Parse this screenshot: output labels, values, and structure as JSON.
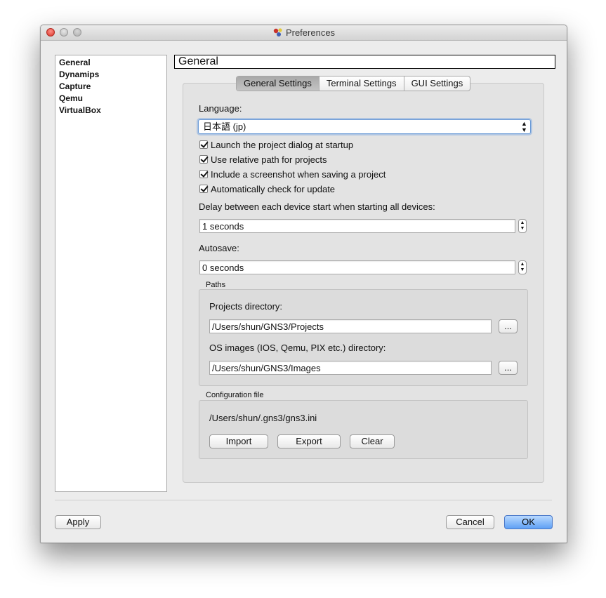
{
  "window": {
    "title": "Preferences"
  },
  "sidebar": {
    "items": [
      {
        "label": "General"
      },
      {
        "label": "Dynamips"
      },
      {
        "label": "Capture"
      },
      {
        "label": "Qemu"
      },
      {
        "label": "VirtualBox"
      }
    ]
  },
  "page": {
    "header": "General"
  },
  "tabs": [
    {
      "label": "General Settings",
      "active": true
    },
    {
      "label": "Terminal Settings",
      "active": false
    },
    {
      "label": "GUI Settings",
      "active": false
    }
  ],
  "general": {
    "language_label": "Language:",
    "language_value": "日本語 (jp)",
    "checkboxes": [
      {
        "label": "Launch the project dialog at startup",
        "checked": true
      },
      {
        "label": "Use relative path for projects",
        "checked": true
      },
      {
        "label": "Include a screenshot when saving a project",
        "checked": true
      },
      {
        "label": "Automatically check for update",
        "checked": true
      }
    ],
    "delay_label": "Delay between each device start when starting all devices:",
    "delay_value": "1 seconds",
    "autosave_label": "Autosave:",
    "autosave_value": "0 seconds"
  },
  "paths": {
    "group_title": "Paths",
    "projects_label": "Projects directory:",
    "projects_value": "/Users/shun/GNS3/Projects",
    "images_label": "OS images (IOS, Qemu, PIX etc.) directory:",
    "images_value": "/Users/shun/GNS3/Images",
    "browse_label": "..."
  },
  "config": {
    "group_title": "Configuration file",
    "path": "/Users/shun/.gns3/gns3.ini",
    "import_label": "Import",
    "export_label": "Export",
    "clear_label": "Clear"
  },
  "footer": {
    "apply_label": "Apply",
    "cancel_label": "Cancel",
    "ok_label": "OK"
  },
  "colors": {
    "accent": "#5fa0f5",
    "close": "#d9352b"
  }
}
